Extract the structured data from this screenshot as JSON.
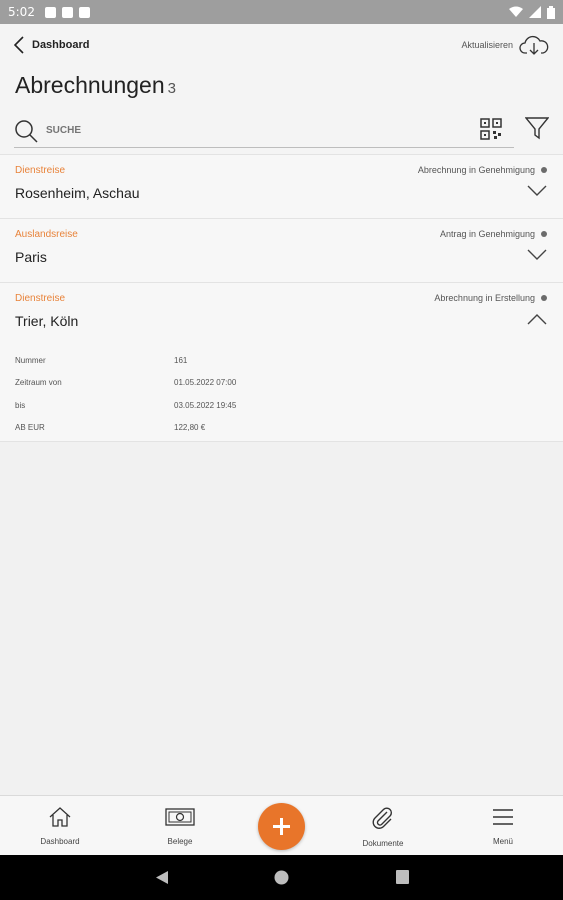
{
  "statusbar": {
    "time": "5:02"
  },
  "header": {
    "back_label": "Dashboard",
    "refresh_label": "Aktualisieren",
    "title": "Abrechnungen",
    "count": "3"
  },
  "search": {
    "placeholder": "SUCHE"
  },
  "items": [
    {
      "category": "Dienstreise",
      "status": "Abrechnung in Genehmigung",
      "name": "Rosenheim, Aschau"
    },
    {
      "category": "Auslandsreise",
      "status": "Antrag in Genehmigung",
      "name": "Paris"
    },
    {
      "category": "Dienstreise",
      "status": "Abrechnung in Erstellung",
      "name": "Trier, Köln",
      "details": [
        {
          "label": "Nummer",
          "value": "161"
        },
        {
          "label": "Zeitraum von",
          "value": "01.05.2022 07:00"
        },
        {
          "label": "bis",
          "value": "03.05.2022 19:45"
        },
        {
          "label": "AB EUR",
          "value": "122,80 €"
        }
      ]
    }
  ],
  "nav": {
    "dashboard": "Dashboard",
    "belege": "Belege",
    "dokumente": "Dokumente",
    "menu": "Menü"
  },
  "colors": {
    "accent": "#e8752a",
    "category": "#e8833a"
  }
}
